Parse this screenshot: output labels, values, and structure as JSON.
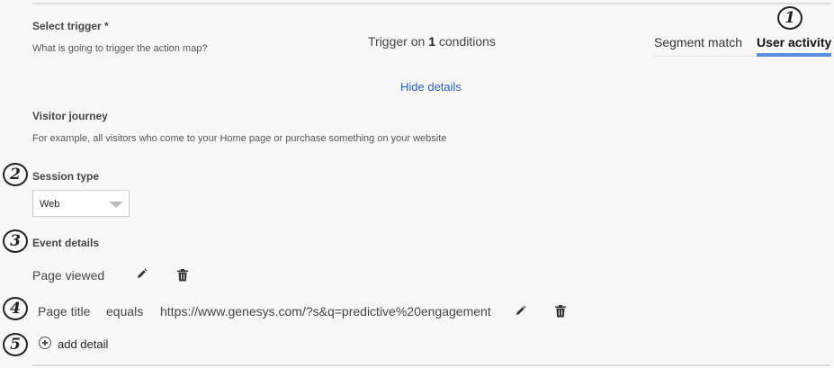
{
  "trigger": {
    "title": "Select trigger *",
    "subtitle": "What is going to trigger the action map?",
    "summary_prefix": "Trigger on ",
    "summary_count": "1",
    "summary_suffix": " conditions",
    "tabs": [
      {
        "label": "Segment match",
        "active": false
      },
      {
        "label": "User activity",
        "active": true
      }
    ],
    "toggle_details": "Hide details"
  },
  "journey": {
    "title": "Visitor journey",
    "description": "For example, all visitors who come to your Home page or purchase something on your website"
  },
  "session": {
    "label": "Session type",
    "selected": "Web"
  },
  "event": {
    "label": "Event details",
    "name": "Page viewed",
    "detail": {
      "field": "Page title",
      "operator": "equals",
      "value": "https://www.genesys.com/?s&q=predictive%20engagement"
    },
    "add_detail_label": "add detail"
  },
  "callouts": [
    "1",
    "2",
    "3",
    "4",
    "5"
  ],
  "icons": {
    "edit": "pencil-icon",
    "delete": "trash-icon",
    "add": "plus-circle-icon"
  },
  "colors": {
    "accent": "#2a60c8",
    "active_tab_underline": "#5b8fe0",
    "background": "#f8f8f8"
  }
}
